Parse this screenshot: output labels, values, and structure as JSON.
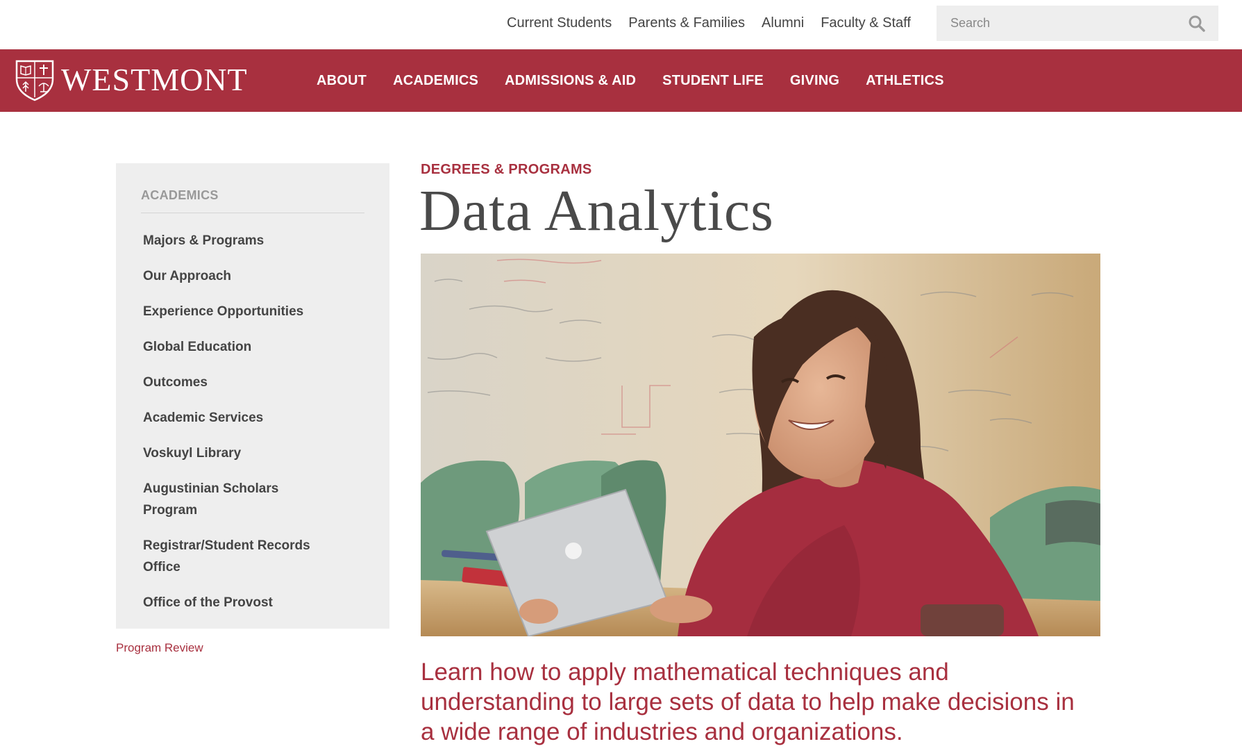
{
  "utility_nav": {
    "links": [
      "Current Students",
      "Parents & Families",
      "Alumni",
      "Faculty & Staff"
    ],
    "search_placeholder": "Search"
  },
  "brand": {
    "name": "WESTMONT",
    "color": "#a8303f"
  },
  "main_nav": {
    "items": [
      "ABOUT",
      "ACADEMICS",
      "ADMISSIONS & AID",
      "STUDENT LIFE",
      "GIVING",
      "ATHLETICS"
    ]
  },
  "sidebar": {
    "title": "ACADEMICS",
    "items": [
      "Majors & Programs",
      "Our Approach",
      "Experience Opportunities",
      "Global Education",
      "Outcomes",
      "Academic Services",
      "Voskuyl Library",
      "Augustinian Scholars Program",
      "Registrar/Student Records Office",
      "Office of the Provost"
    ],
    "extra_link": "Program Review"
  },
  "main": {
    "eyebrow": "DEGREES & PROGRAMS",
    "title": "Data Analytics",
    "intro": "Learn how to apply mathematical techniques and understanding to large sets of data to help make decisions in a wide range of industries and organizations."
  },
  "icons": {
    "search": "search-icon",
    "crest": "crest-icon"
  }
}
